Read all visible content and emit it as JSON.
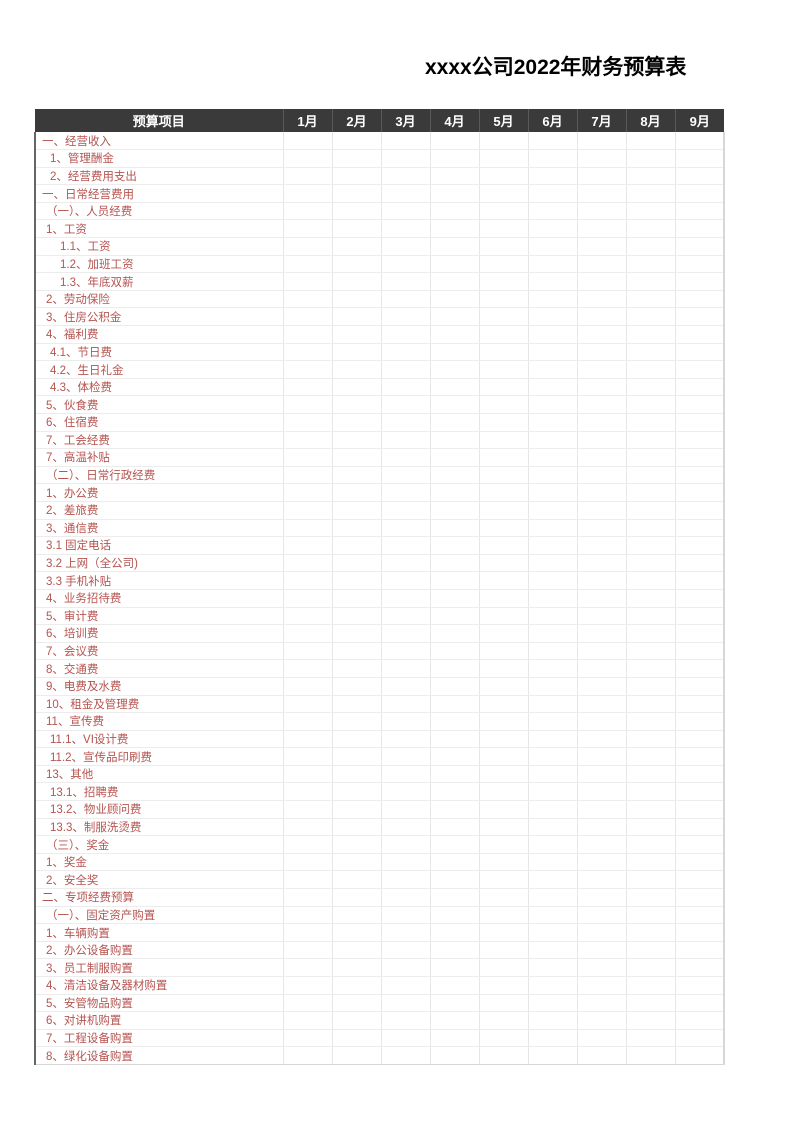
{
  "document": {
    "title": "xxxx公司2022年财务预算表"
  },
  "table": {
    "item_column_header": "预算项目",
    "month_headers": [
      "1月",
      "2月",
      "3月",
      "4月",
      "5月",
      "6月",
      "7月",
      "8月",
      "9月"
    ],
    "header_bg": "#3a3a3a",
    "header_text_color": "#ffffff",
    "row_text_color": "#b55450",
    "gridline_color": "#e8e8e8",
    "rows": [
      {
        "label": "一、经营收入",
        "indent": 0,
        "values": [
          "",
          "",
          "",
          "",
          "",
          "",
          "",
          "",
          ""
        ]
      },
      {
        "label": "1、管理酬金",
        "indent": 2,
        "values": [
          "",
          "",
          "",
          "",
          "",
          "",
          "",
          "",
          ""
        ]
      },
      {
        "label": "2、经营费用支出",
        "indent": 2,
        "values": [
          "",
          "",
          "",
          "",
          "",
          "",
          "",
          "",
          ""
        ]
      },
      {
        "label": "一、日常经营费用",
        "indent": 0,
        "values": [
          "",
          "",
          "",
          "",
          "",
          "",
          "",
          "",
          ""
        ]
      },
      {
        "label": "（一）、人员经费",
        "indent": 1,
        "values": [
          "",
          "",
          "",
          "",
          "",
          "",
          "",
          "",
          ""
        ]
      },
      {
        "label": "1、工资",
        "indent": 1,
        "values": [
          "",
          "",
          "",
          "",
          "",
          "",
          "",
          "",
          ""
        ]
      },
      {
        "label": "1.1、工资",
        "indent": 3,
        "values": [
          "",
          "",
          "",
          "",
          "",
          "",
          "",
          "",
          ""
        ]
      },
      {
        "label": "1.2、加班工资",
        "indent": 3,
        "values": [
          "",
          "",
          "",
          "",
          "",
          "",
          "",
          "",
          ""
        ]
      },
      {
        "label": "1.3、年底双薪",
        "indent": 3,
        "values": [
          "",
          "",
          "",
          "",
          "",
          "",
          "",
          "",
          ""
        ]
      },
      {
        "label": "2、劳动保险",
        "indent": 1,
        "values": [
          "",
          "",
          "",
          "",
          "",
          "",
          "",
          "",
          ""
        ]
      },
      {
        "label": "3、住房公积金",
        "indent": 1,
        "values": [
          "",
          "",
          "",
          "",
          "",
          "",
          "",
          "",
          ""
        ]
      },
      {
        "label": "4、福利费",
        "indent": 1,
        "values": [
          "",
          "",
          "",
          "",
          "",
          "",
          "",
          "",
          ""
        ]
      },
      {
        "label": "4.1、节日费",
        "indent": 2,
        "values": [
          "",
          "",
          "",
          "",
          "",
          "",
          "",
          "",
          ""
        ]
      },
      {
        "label": "4.2、生日礼金",
        "indent": 2,
        "values": [
          "",
          "",
          "",
          "",
          "",
          "",
          "",
          "",
          ""
        ]
      },
      {
        "label": "4.3、体检费",
        "indent": 2,
        "values": [
          "",
          "",
          "",
          "",
          "",
          "",
          "",
          "",
          ""
        ]
      },
      {
        "label": "5、伙食费",
        "indent": 1,
        "values": [
          "",
          "",
          "",
          "",
          "",
          "",
          "",
          "",
          ""
        ]
      },
      {
        "label": "6、住宿费",
        "indent": 1,
        "values": [
          "",
          "",
          "",
          "",
          "",
          "",
          "",
          "",
          ""
        ]
      },
      {
        "label": "7、工会经费",
        "indent": 1,
        "values": [
          "",
          "",
          "",
          "",
          "",
          "",
          "",
          "",
          ""
        ]
      },
      {
        "label": "7、高温补贴",
        "indent": 1,
        "values": [
          "",
          "",
          "",
          "",
          "",
          "",
          "",
          "",
          ""
        ]
      },
      {
        "label": "（二）、日常行政经费",
        "indent": 1,
        "values": [
          "",
          "",
          "",
          "",
          "",
          "",
          "",
          "",
          ""
        ]
      },
      {
        "label": "1、办公费",
        "indent": 1,
        "values": [
          "",
          "",
          "",
          "",
          "",
          "",
          "",
          "",
          ""
        ]
      },
      {
        "label": "2、差旅费",
        "indent": 1,
        "values": [
          "",
          "",
          "",
          "",
          "",
          "",
          "",
          "",
          ""
        ]
      },
      {
        "label": "3、通信费",
        "indent": 1,
        "values": [
          "",
          "",
          "",
          "",
          "",
          "",
          "",
          "",
          ""
        ]
      },
      {
        "label": "3.1  固定电话",
        "indent": 1,
        "values": [
          "",
          "",
          "",
          "",
          "",
          "",
          "",
          "",
          ""
        ]
      },
      {
        "label": "3.2 上网（全公司)",
        "indent": 1,
        "values": [
          "",
          "",
          "",
          "",
          "",
          "",
          "",
          "",
          ""
        ]
      },
      {
        "label": "3.3 手机补贴",
        "indent": 1,
        "values": [
          "",
          "",
          "",
          "",
          "",
          "",
          "",
          "",
          ""
        ]
      },
      {
        "label": "4、业务招待费",
        "indent": 1,
        "values": [
          "",
          "",
          "",
          "",
          "",
          "",
          "",
          "",
          ""
        ]
      },
      {
        "label": "5、审计费",
        "indent": 1,
        "values": [
          "",
          "",
          "",
          "",
          "",
          "",
          "",
          "",
          ""
        ]
      },
      {
        "label": "6、培训费",
        "indent": 1,
        "values": [
          "",
          "",
          "",
          "",
          "",
          "",
          "",
          "",
          ""
        ]
      },
      {
        "label": "7、会议费",
        "indent": 1,
        "values": [
          "",
          "",
          "",
          "",
          "",
          "",
          "",
          "",
          ""
        ]
      },
      {
        "label": "8、交通费",
        "indent": 1,
        "values": [
          "",
          "",
          "",
          "",
          "",
          "",
          "",
          "",
          ""
        ]
      },
      {
        "label": "9、电费及水费",
        "indent": 1,
        "values": [
          "",
          "",
          "",
          "",
          "",
          "",
          "",
          "",
          ""
        ]
      },
      {
        "label": "10、租金及管理费",
        "indent": 1,
        "values": [
          "",
          "",
          "",
          "",
          "",
          "",
          "",
          "",
          ""
        ]
      },
      {
        "label": "11、宣传费",
        "indent": 1,
        "values": [
          "",
          "",
          "",
          "",
          "",
          "",
          "",
          "",
          ""
        ]
      },
      {
        "label": "11.1、VI设计费",
        "indent": 2,
        "values": [
          "",
          "",
          "",
          "",
          "",
          "",
          "",
          "",
          ""
        ]
      },
      {
        "label": "11.2、宣传品印刷费",
        "indent": 2,
        "values": [
          "",
          "",
          "",
          "",
          "",
          "",
          "",
          "",
          ""
        ]
      },
      {
        "label": "13、其他",
        "indent": 1,
        "values": [
          "",
          "",
          "",
          "",
          "",
          "",
          "",
          "",
          ""
        ]
      },
      {
        "label": "13.1、招聘费",
        "indent": 2,
        "values": [
          "",
          "",
          "",
          "",
          "",
          "",
          "",
          "",
          ""
        ]
      },
      {
        "label": "13.2、物业顾问费",
        "indent": 2,
        "values": [
          "",
          "",
          "",
          "",
          "",
          "",
          "",
          "",
          ""
        ]
      },
      {
        "label": "13.3、制服洗烫费",
        "indent": 2,
        "values": [
          "",
          "",
          "",
          "",
          "",
          "",
          "",
          "",
          ""
        ]
      },
      {
        "label": "（三）、奖金",
        "indent": 1,
        "values": [
          "",
          "",
          "",
          "",
          "",
          "",
          "",
          "",
          ""
        ]
      },
      {
        "label": "1、奖金",
        "indent": 1,
        "values": [
          "",
          "",
          "",
          "",
          "",
          "",
          "",
          "",
          ""
        ]
      },
      {
        "label": "2、安全奖",
        "indent": 1,
        "values": [
          "",
          "",
          "",
          "",
          "",
          "",
          "",
          "",
          ""
        ]
      },
      {
        "label": "二、专项经费预算",
        "indent": 0,
        "values": [
          "",
          "",
          "",
          "",
          "",
          "",
          "",
          "",
          ""
        ]
      },
      {
        "label": "（一）、固定资产购置",
        "indent": 1,
        "values": [
          "",
          "",
          "",
          "",
          "",
          "",
          "",
          "",
          ""
        ]
      },
      {
        "label": "1、车辆购置",
        "indent": 1,
        "values": [
          "",
          "",
          "",
          "",
          "",
          "",
          "",
          "",
          ""
        ]
      },
      {
        "label": "2、办公设备购置",
        "indent": 1,
        "values": [
          "",
          "",
          "",
          "",
          "",
          "",
          "",
          "",
          ""
        ]
      },
      {
        "label": "3、员工制服购置",
        "indent": 1,
        "values": [
          "",
          "",
          "",
          "",
          "",
          "",
          "",
          "",
          ""
        ]
      },
      {
        "label": "4、清洁设备及器材购置",
        "indent": 1,
        "values": [
          "",
          "",
          "",
          "",
          "",
          "",
          "",
          "",
          ""
        ]
      },
      {
        "label": "5、安管物品购置",
        "indent": 1,
        "values": [
          "",
          "",
          "",
          "",
          "",
          "",
          "",
          "",
          ""
        ]
      },
      {
        "label": "6、对讲机购置",
        "indent": 1,
        "values": [
          "",
          "",
          "",
          "",
          "",
          "",
          "",
          "",
          ""
        ]
      },
      {
        "label": "7、工程设备购置",
        "indent": 1,
        "values": [
          "",
          "",
          "",
          "",
          "",
          "",
          "",
          "",
          ""
        ]
      },
      {
        "label": "8、绿化设备购置",
        "indent": 1,
        "values": [
          "",
          "",
          "",
          "",
          "",
          "",
          "",
          "",
          ""
        ]
      }
    ]
  }
}
